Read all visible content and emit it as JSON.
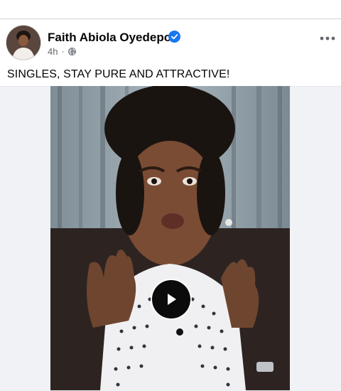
{
  "post": {
    "author": "Faith Abiola Oyedepo",
    "verified": true,
    "time": "4h",
    "separator": "·",
    "privacy_icon": "globe-icon",
    "more_icon": "more-options-icon",
    "caption": "SINGLES, STAY PURE AND ATTRACTIVE!"
  },
  "media": {
    "type": "video",
    "play_icon": "play-icon"
  },
  "colors": {
    "verified_blue": "#1877f2",
    "secondary_text": "#65676b",
    "primary_text": "#050505"
  }
}
